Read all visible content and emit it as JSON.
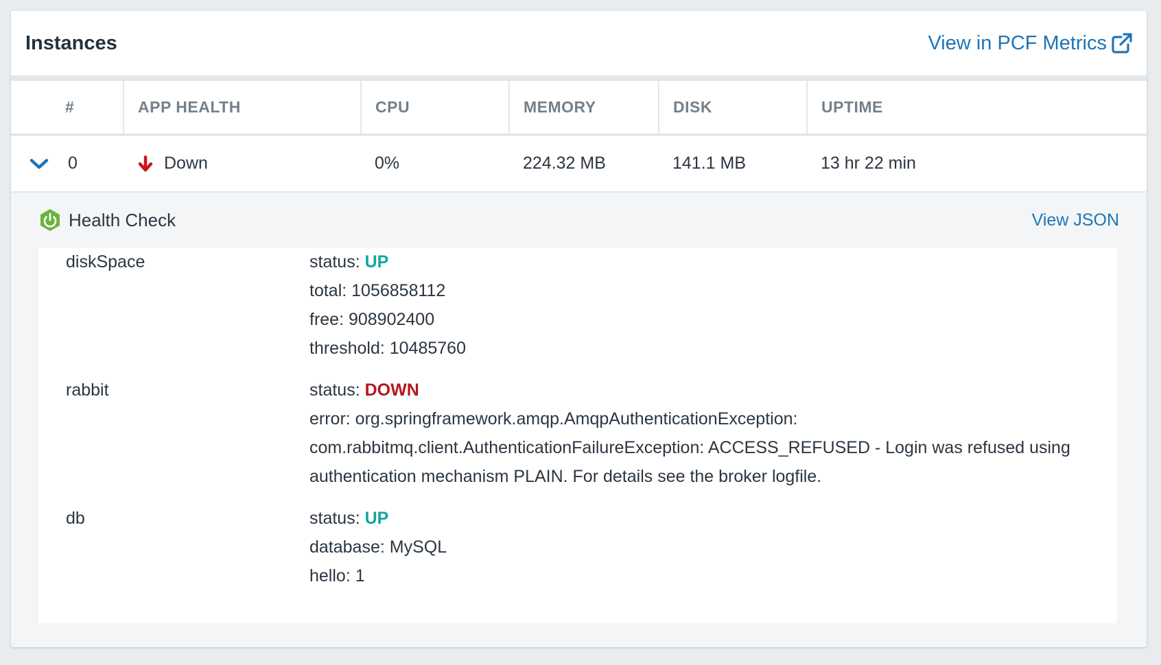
{
  "header": {
    "title": "Instances",
    "metrics_link": "View in PCF Metrics"
  },
  "table": {
    "columns": [
      "#",
      "APP HEALTH",
      "CPU",
      "MEMORY",
      "DISK",
      "UPTIME"
    ],
    "rows": [
      {
        "index": "0",
        "health": "Down",
        "cpu": "0%",
        "memory": "224.32 MB",
        "disk": "141.1 MB",
        "uptime": "13 hr 22 min"
      }
    ]
  },
  "health_check": {
    "title": "Health Check",
    "view_json": "View JSON",
    "entries": [
      {
        "name": "diskSpace",
        "status_label": "status: ",
        "status": "UP",
        "details": [
          "total: 1056858112",
          "free: 908902400",
          "threshold: 10485760"
        ]
      },
      {
        "name": "rabbit",
        "status_label": "status: ",
        "status": "DOWN",
        "details": [
          "error: org.springframework.amqp.AmqpAuthenticationException: com.rabbitmq.client.AuthenticationFailureException: ACCESS_REFUSED - Login was refused using authentication mechanism PLAIN. For details see the broker logfile."
        ]
      },
      {
        "name": "db",
        "status_label": "status: ",
        "status": "UP",
        "details": [
          "database: MySQL",
          "hello: 1"
        ]
      }
    ]
  },
  "colors": {
    "link": "#1e74b6",
    "status_up": "#12a79d",
    "status_down": "#b5161f",
    "spring_green": "#6db33f"
  },
  "icons": {
    "external_link": "external-link-icon",
    "expand": "chevron-down-icon",
    "health_down": "arrow-down-icon",
    "spring": "spring-power-icon"
  }
}
